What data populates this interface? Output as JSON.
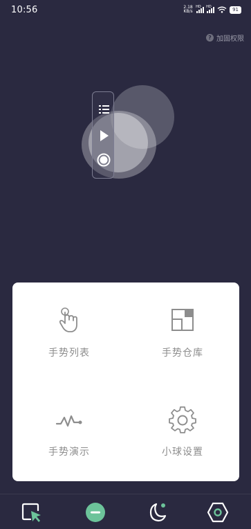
{
  "status_bar": {
    "time": "10:56",
    "net_speed_value": "2.18",
    "net_speed_unit": "KB/s",
    "signal_tag": "HD",
    "battery": "91"
  },
  "header": {
    "permission_link": "加固权限",
    "help_icon": "question-circle-icon"
  },
  "ball_demo": {
    "items": [
      {
        "icon": "list-icon"
      },
      {
        "icon": "play-icon"
      },
      {
        "icon": "record-icon"
      }
    ]
  },
  "menu": {
    "items": [
      {
        "label": "手势列表",
        "icon": "tap-gesture-icon"
      },
      {
        "label": "手势仓库",
        "icon": "gesture-repo-icon"
      },
      {
        "label": "手势演示",
        "icon": "wave-icon"
      },
      {
        "label": "小球设置",
        "icon": "gear-icon"
      }
    ]
  },
  "bottom_nav": {
    "items": [
      {
        "icon": "cursor-square-icon"
      },
      {
        "icon": "minus-circle-icon",
        "color": "#6cc39a",
        "active": true
      },
      {
        "icon": "moon-icon"
      },
      {
        "icon": "hexagon-icon"
      }
    ]
  },
  "colors": {
    "background": "#2a2940",
    "accent": "#6cc39a",
    "card": "#ffffff"
  }
}
